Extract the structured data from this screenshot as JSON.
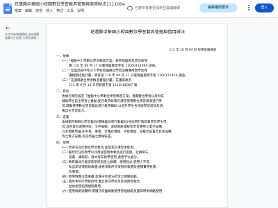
{
  "header": {
    "doc_title": "花蓮縣中華國小校園數位學習載具管理與借用辦法1111004",
    "menu": [
      "檔案",
      "編輯",
      "檢視",
      "插入",
      "格式",
      "工具",
      "說明"
    ],
    "cloud_status": "已將所有變更儲存至雲端硬碟",
    "request_edit_label": "編輯權限要求",
    "sign_in_label": "登入"
  },
  "sidebar": {
    "outline_hint": "文件中新增標題後,這些標題會顯示在這裡,方便您查閱。"
  },
  "document": {
    "title": "花蓮縣中華國小校園數位學習載具管理與借用辦法",
    "date": "111 年 10 月 04 日 校務會議通過",
    "lines": [
      "一、依據",
      "(一)「推動中小學數位學習精進方案」教育部國民及學前教育",
      "署 110 年 09 月 17 日臺教國署資字第 1100043309A 號函。",
      "(二)「全國高級中等以下學校校園數位學習設備應用暨學生保",
      "護相關措施計畫」教育部 110 年 09 月 17 日臺教國署資字第 1100121819 號函。",
      "(三)「花蓮縣數位學習精進實施計畫」花蓮縣政府",
      "111 年 9 月 19 日府教資字第 1110188367 號",
      "二、目的",
      "依據行政院核定「推動中小學數位學習精進方案」落實數位學習以及科技",
      "輔助學生自主學習之推動,配合教育政策於課堂使用數位學習資源進行學",
      "習,鼓勵使用數位學習載具進行教學輔助,以提升學生各領域學習成效及培",
      "養自主學習能力。",
      "三、定義",
      "本規範所稱數位學習載具(簡稱載具或行動載具)係指用於教師教學及學生學",
      "習,具有資料運算存取、文件編輯、連結網路連線等學習應用之電子設備,",
      "以及相關周邊,如平板、筆電、可攜式電腦、平板電腦、穿戴式裝置及其他設備",
      "等之電子設備,及其周邊之無線裝置。",
      "四、使用:",
      "(一) 本辦法旨於數位學習載具,並使其於課堂中使用。",
      "(二) 嚴禁於任何教學以外用途使用本載具進行遊戲、社群聊天、",
      "遊戲、攝錄影、發文等非教學使用,違者予以處分。",
      "(三) 教育載具只能安裝學校指定之軟體、應用程式,使用人不得",
      "私自新增或刪除軟體,違者須對所涉安裝的軟體及相關費用負責",
      "及賠償。",
      "(四) 使用時應注意維護,並遵守本辦法所定之相關規範。",
      "(五) 遺失本校行政載具時,應立即向學校及其他教師報告,",
      "並依規定賠償相關費用。",
      "(六) 使用網路瀏覽時,需遵守校園網路使用管理規範及臺灣學術網路使用"
    ]
  }
}
